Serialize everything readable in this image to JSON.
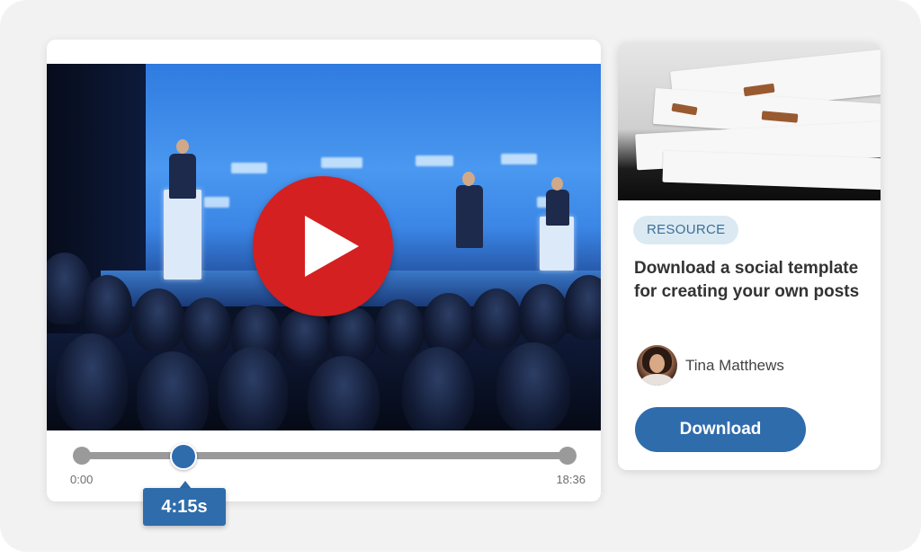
{
  "video": {
    "current_time_label": "4:15s",
    "start_time": "0:00",
    "end_time": "18:36",
    "progress": 0.228,
    "play_button_color": "#d42020",
    "accent_color": "#2f6cac"
  },
  "resource_card": {
    "badge": "RESOURCE",
    "title": "Download a social template for creating your own posts",
    "author_name": "Tina Matthews",
    "download_label": "Download",
    "badge_bg": "#dbeaf2",
    "button_color": "#2f6cac"
  }
}
